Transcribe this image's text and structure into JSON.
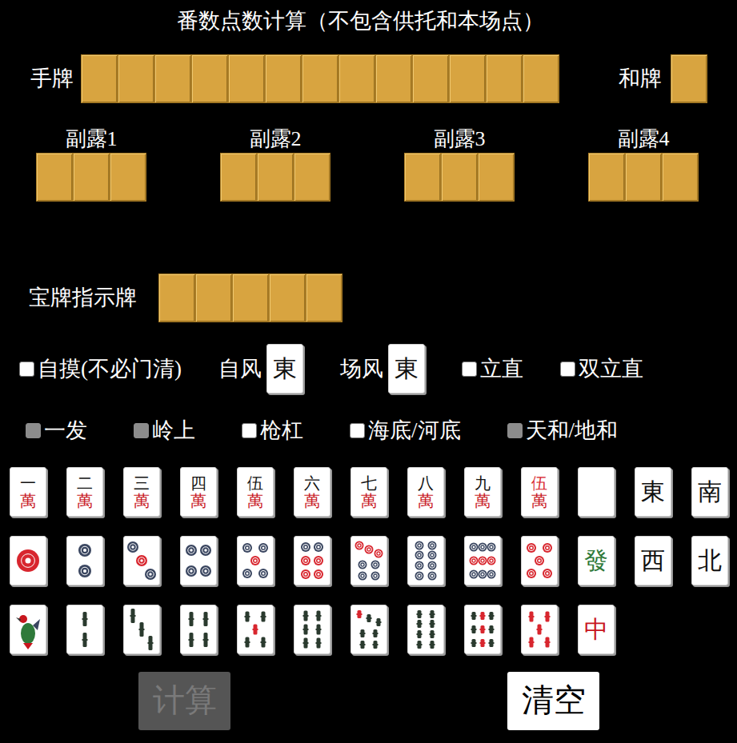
{
  "title": "番数点数计算（不包含供托和本场点）",
  "hand": {
    "label": "手牌",
    "slots": 13
  },
  "winning_tile": {
    "label": "和牌",
    "slots": 1
  },
  "melds": [
    {
      "label": "副露1",
      "slots": 3
    },
    {
      "label": "副露2",
      "slots": 3
    },
    {
      "label": "副露3",
      "slots": 3
    },
    {
      "label": "副露4",
      "slots": 3
    }
  ],
  "dora": {
    "label": "宝牌指示牌",
    "slots": 5
  },
  "options_row1": [
    {
      "kind": "checkbox",
      "label": "自摸(不必门清)",
      "checked": false,
      "disabled": false
    },
    {
      "kind": "wind",
      "label": "自风",
      "value": "東"
    },
    {
      "kind": "wind",
      "label": "场风",
      "value": "東"
    },
    {
      "kind": "checkbox",
      "label": "立直",
      "checked": false,
      "disabled": false
    },
    {
      "kind": "checkbox",
      "label": "双立直",
      "checked": false,
      "disabled": false
    }
  ],
  "options_row2": [
    {
      "kind": "checkbox",
      "label": "一发",
      "checked": false,
      "disabled": true
    },
    {
      "kind": "checkbox",
      "label": "岭上",
      "checked": false,
      "disabled": true
    },
    {
      "kind": "checkbox",
      "label": "枪杠",
      "checked": false,
      "disabled": false
    },
    {
      "kind": "checkbox",
      "label": "海底/河底",
      "checked": false,
      "disabled": false
    },
    {
      "kind": "checkbox",
      "label": "天和/地和",
      "checked": false,
      "disabled": true
    }
  ],
  "palette": [
    [
      {
        "kind": "man",
        "text": "一",
        "suffix": "萬",
        "red": false
      },
      {
        "kind": "man",
        "text": "二",
        "suffix": "萬",
        "red": false
      },
      {
        "kind": "man",
        "text": "三",
        "suffix": "萬",
        "red": false
      },
      {
        "kind": "man",
        "text": "四",
        "suffix": "萬",
        "red": false
      },
      {
        "kind": "man",
        "text": "伍",
        "suffix": "萬",
        "red": false
      },
      {
        "kind": "man",
        "text": "六",
        "suffix": "萬",
        "red": false
      },
      {
        "kind": "man",
        "text": "七",
        "suffix": "萬",
        "red": false
      },
      {
        "kind": "man",
        "text": "八",
        "suffix": "萬",
        "red": false
      },
      {
        "kind": "man",
        "text": "九",
        "suffix": "萬",
        "red": false
      },
      {
        "kind": "man",
        "text": "伍",
        "suffix": "萬",
        "red": true
      },
      {
        "kind": "honor",
        "text": "",
        "color": "#ffffff"
      },
      {
        "kind": "honor",
        "text": "東",
        "color": "#111111"
      },
      {
        "kind": "honor",
        "text": "南",
        "color": "#111111"
      }
    ],
    [
      {
        "kind": "pin",
        "number": 1,
        "red": false
      },
      {
        "kind": "pin",
        "number": 2,
        "red": false
      },
      {
        "kind": "pin",
        "number": 3,
        "red": false
      },
      {
        "kind": "pin",
        "number": 4,
        "red": false
      },
      {
        "kind": "pin",
        "number": 5,
        "red": false
      },
      {
        "kind": "pin",
        "number": 6,
        "red": false
      },
      {
        "kind": "pin",
        "number": 7,
        "red": false
      },
      {
        "kind": "pin",
        "number": 8,
        "red": false
      },
      {
        "kind": "pin",
        "number": 9,
        "red": false
      },
      {
        "kind": "pin",
        "number": 5,
        "red": true
      },
      {
        "kind": "honor",
        "text": "發",
        "color": "#2f7a3a"
      },
      {
        "kind": "honor",
        "text": "西",
        "color": "#111111"
      },
      {
        "kind": "honor",
        "text": "北",
        "color": "#111111"
      }
    ],
    [
      {
        "kind": "sou",
        "number": 1,
        "red": false
      },
      {
        "kind": "sou",
        "number": 2,
        "red": false
      },
      {
        "kind": "sou",
        "number": 3,
        "red": false
      },
      {
        "kind": "sou",
        "number": 4,
        "red": false
      },
      {
        "kind": "sou",
        "number": 5,
        "red": false
      },
      {
        "kind": "sou",
        "number": 6,
        "red": false
      },
      {
        "kind": "sou",
        "number": 7,
        "red": false
      },
      {
        "kind": "sou",
        "number": 8,
        "red": false
      },
      {
        "kind": "sou",
        "number": 9,
        "red": false
      },
      {
        "kind": "sou",
        "number": 5,
        "red": true
      },
      {
        "kind": "honor",
        "text": "中",
        "color": "#c8161d"
      }
    ]
  ],
  "buttons": [
    {
      "label": "计算",
      "disabled": true
    },
    {
      "label": "清空",
      "disabled": false
    }
  ]
}
